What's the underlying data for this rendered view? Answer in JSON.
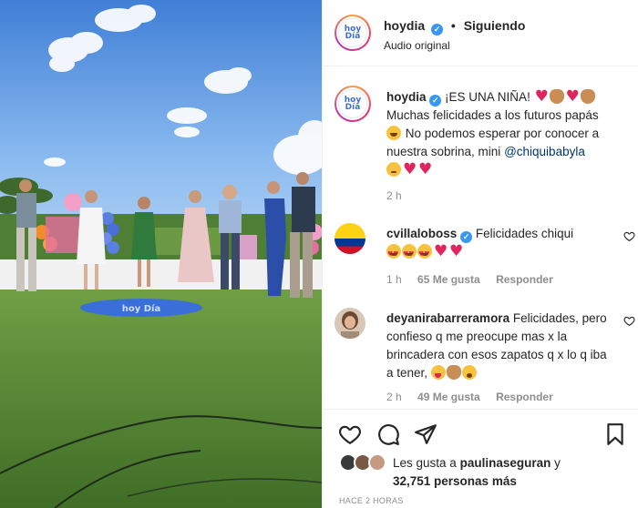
{
  "post": {
    "account": "hoydia",
    "follow_status": "Siguiendo",
    "separator": "•",
    "audio": "Audio original",
    "logo_text": [
      "hoy",
      "Día"
    ],
    "caption_parts": [
      "¡ES UNA NIÑA!",
      "Muchas felicidades a los futuros papás",
      "No podemos esperar por conocer a nuestra sobrina, mini",
      "@chiquibabyla"
    ],
    "caption_time": "2 h"
  },
  "comments": [
    {
      "user": "cvillaloboss",
      "text": "Felicidades chiqui",
      "time": "1 h",
      "likes": "65 Me gusta",
      "reply": "Responder"
    },
    {
      "user": "deyanirabarreramora",
      "text": "Felicidades, pero confieso q me preocupe mas x la brincadera con esos zapatos q x lo q iba a tener,",
      "time": "2 h",
      "likes": "49 Me gusta",
      "reply": "Responder"
    }
  ],
  "likes_summary": {
    "prefix": "Les gusta a",
    "user": "paulinaseguran",
    "joiner": "y",
    "count": "32,751 personas más"
  },
  "posted_ago": "HACE 2 HORAS",
  "colors": {
    "verified": "#3897f0",
    "mention": "#00376b",
    "muted": "#8e8e8e",
    "sky": "#7fb0e8",
    "grass": "#5c8a3a"
  },
  "icons": {
    "like": "heart-outline-icon",
    "comment": "comment-bubble-icon",
    "share": "paper-plane-icon",
    "save": "bookmark-icon"
  }
}
